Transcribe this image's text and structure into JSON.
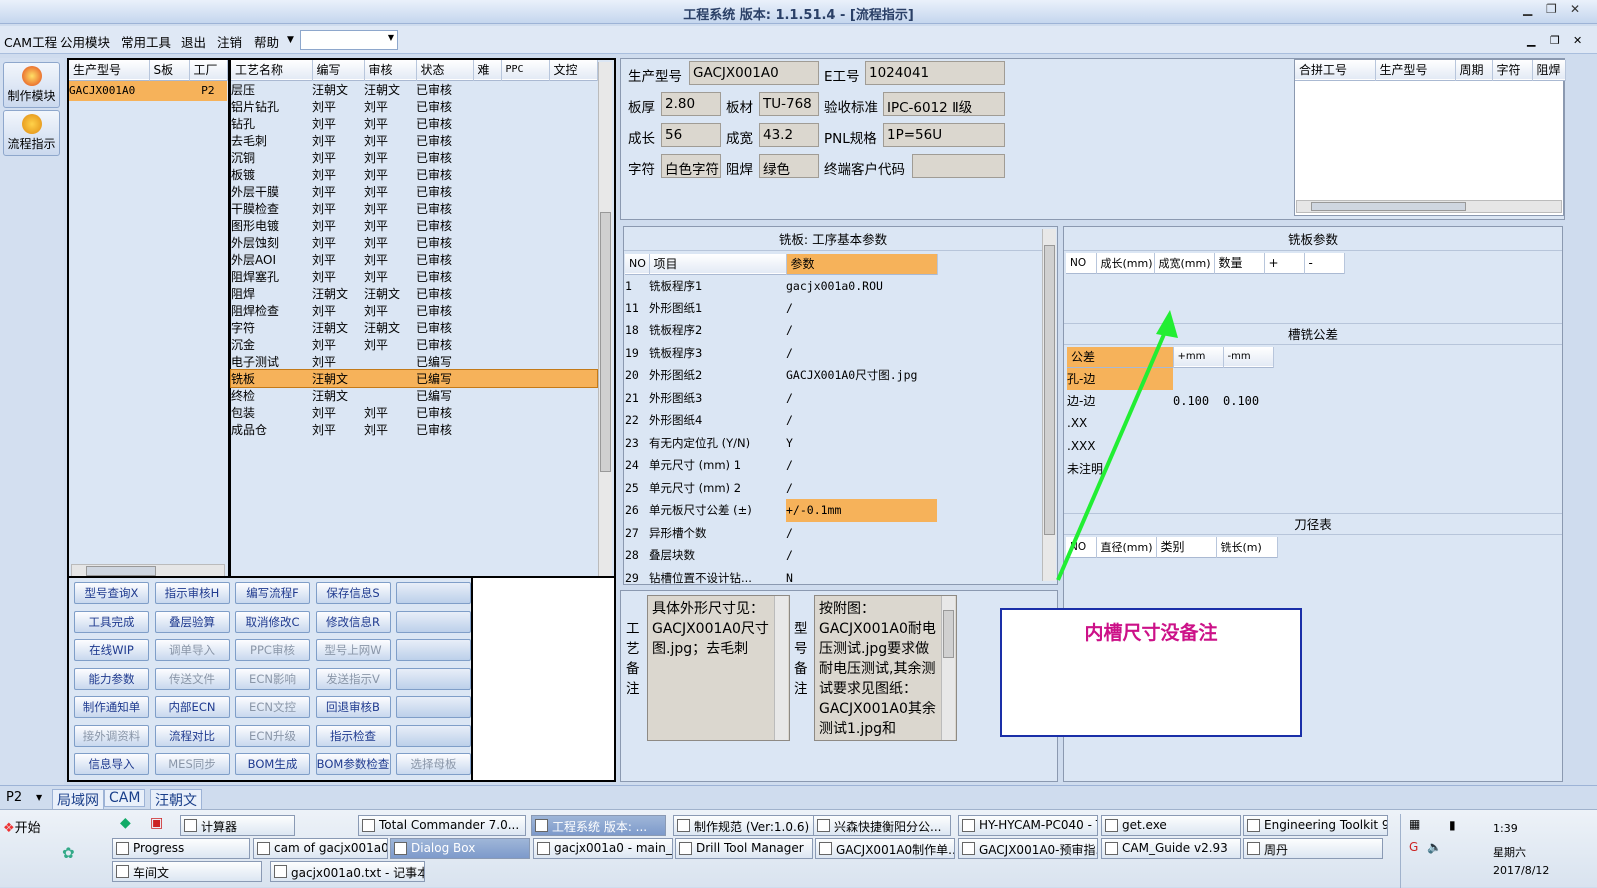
{
  "window": {
    "title": "工程系统  版本: 1.1.51.4 - [流程指示]"
  },
  "menu": [
    "CAM工程",
    "公用模块",
    "常用工具",
    "退出",
    "注销",
    "帮助"
  ],
  "left_tools": [
    {
      "label": "制作模块"
    },
    {
      "label": "流程指示"
    }
  ],
  "models": {
    "headers": [
      "生产型号",
      "S板",
      "工厂"
    ],
    "rows": [
      [
        "GACJX001A0",
        "",
        "P2"
      ]
    ]
  },
  "process": {
    "headers": [
      "工艺名称",
      "编写",
      "审核",
      "状态",
      "难",
      "PPC",
      "文控"
    ],
    "rows": [
      [
        "层压",
        "汪朝文",
        "汪朝文",
        "已审核"
      ],
      [
        "铝片钻孔",
        "刘平",
        "刘平",
        "已审核"
      ],
      [
        "钻孔",
        "刘平",
        "刘平",
        "已审核"
      ],
      [
        "去毛刺",
        "刘平",
        "刘平",
        "已审核"
      ],
      [
        "沉铜",
        "刘平",
        "刘平",
        "已审核"
      ],
      [
        "板镀",
        "刘平",
        "刘平",
        "已审核"
      ],
      [
        "外层干膜",
        "刘平",
        "刘平",
        "已审核"
      ],
      [
        "干膜检查",
        "刘平",
        "刘平",
        "已审核"
      ],
      [
        "图形电镀",
        "刘平",
        "刘平",
        "已审核"
      ],
      [
        "外层蚀刻",
        "刘平",
        "刘平",
        "已审核"
      ],
      [
        "外层AOI",
        "刘平",
        "刘平",
        "已审核"
      ],
      [
        "阻焊塞孔",
        "刘平",
        "刘平",
        "已审核"
      ],
      [
        "阻焊",
        "汪朝文",
        "汪朝文",
        "已审核"
      ],
      [
        "阻焊检查",
        "刘平",
        "刘平",
        "已审核"
      ],
      [
        "字符",
        "汪朝文",
        "汪朝文",
        "已审核"
      ],
      [
        "沉金",
        "刘平",
        "刘平",
        "已审核"
      ],
      [
        "电子测试",
        "刘平",
        "",
        "已编写"
      ],
      [
        "铣板",
        "汪朝文",
        "",
        "已编写"
      ],
      [
        "终检",
        "汪朝文",
        "",
        "已编写"
      ],
      [
        "包装",
        "刘平",
        "刘平",
        "已审核"
      ],
      [
        "成品仓",
        "刘平",
        "刘平",
        "已审核"
      ]
    ],
    "highlight_index": 17
  },
  "buttons": [
    [
      {
        "t": "型号查询X",
        "d": false
      },
      {
        "t": "指示审核H",
        "d": false
      },
      {
        "t": "编写流程F",
        "d": false
      },
      {
        "t": "保存信息S",
        "d": false
      },
      {
        "t": "",
        "d": false
      }
    ],
    [
      {
        "t": "工具完成",
        "d": false
      },
      {
        "t": "叠层验算",
        "d": false
      },
      {
        "t": "取消修改C",
        "d": false
      },
      {
        "t": "修改信息R",
        "d": false
      },
      {
        "t": "",
        "d": false
      }
    ],
    [
      {
        "t": "在线WIP",
        "d": false
      },
      {
        "t": "调单导入",
        "d": true
      },
      {
        "t": "PPC审核",
        "d": true
      },
      {
        "t": "型号上网W",
        "d": true
      },
      {
        "t": "",
        "d": false
      }
    ],
    [
      {
        "t": "能力参数",
        "d": false
      },
      {
        "t": "传送文件",
        "d": true
      },
      {
        "t": "ECN影响",
        "d": true
      },
      {
        "t": "发送指示V",
        "d": true
      },
      {
        "t": "",
        "d": false
      }
    ],
    [
      {
        "t": "制作通知单",
        "d": false
      },
      {
        "t": "内部ECN",
        "d": false
      },
      {
        "t": "ECN文控",
        "d": true
      },
      {
        "t": "回退审核B",
        "d": false
      },
      {
        "t": "",
        "d": false
      }
    ],
    [
      {
        "t": "接外调资料",
        "d": true
      },
      {
        "t": "流程对比",
        "d": false
      },
      {
        "t": "ECN升级",
        "d": true
      },
      {
        "t": "指示检查",
        "d": false
      },
      {
        "t": "",
        "d": false
      }
    ],
    [
      {
        "t": "信息导入",
        "d": false
      },
      {
        "t": "MES同步",
        "d": true
      },
      {
        "t": "BOM生成",
        "d": false
      },
      {
        "t": "BOM参数检查",
        "d": false
      },
      {
        "t": "选择母板",
        "d": true
      }
    ]
  ],
  "info": {
    "l_model": "生产型号",
    "model": "GACJX001A0",
    "l_e": "E工号",
    "e": "1024041",
    "l_thick": "板厚",
    "thick": "2.80",
    "l_mat": "板材",
    "mat": "TU-768",
    "l_std": "验收标准",
    "std": "IPC-6012 Ⅱ级",
    "l_len": "成长",
    "len": "56",
    "l_wid": "成宽",
    "wid": "43.2",
    "l_pnl": "PNL规格",
    "pnl": "1P=56U",
    "l_char": "字符",
    "char": "白色字符",
    "l_mask": "阻焊",
    "mask": "绿色",
    "l_cust": "终端客户代码",
    "cust": ""
  },
  "merge": {
    "headers": [
      "合拼工号",
      "生产型号",
      "周期",
      "字符",
      "阻焊"
    ]
  },
  "params": {
    "title": "铣板: 工序基本参数",
    "headers": [
      "NO",
      "项目",
      "参数"
    ],
    "rows": [
      [
        "1",
        "铣板程序1",
        "gacjx001a0.ROU"
      ],
      [
        "11",
        "外形图纸1",
        "/"
      ],
      [
        "18",
        "铣板程序2",
        "/"
      ],
      [
        "19",
        "铣板程序3",
        "/"
      ],
      [
        "20",
        "外形图纸2",
        "GACJX001A0尺寸图.jpg"
      ],
      [
        "21",
        "外形图纸3",
        "/"
      ],
      [
        "22",
        "外形图纸4",
        "/"
      ],
      [
        "23",
        "有无内定位孔 (Y/N)",
        "Y"
      ],
      [
        "24",
        "单元尺寸 (mm) 1",
        "/"
      ],
      [
        "25",
        "单元尺寸 (mm) 2",
        "/"
      ],
      [
        "26",
        "单元板尺寸公差 (±)",
        "+/-0.1mm"
      ],
      [
        "27",
        "异形槽个数",
        "/"
      ],
      [
        "28",
        "叠层块数",
        "/"
      ],
      [
        "29",
        "钻槽位置不设计钻...",
        "N"
      ]
    ],
    "highlight_index": 10
  },
  "mill": {
    "title": "铣板参数",
    "headers": [
      "NO",
      "成长(mm)",
      "成宽(mm)",
      "数量",
      "+",
      "-"
    ]
  },
  "tol": {
    "title": "槽铣公差",
    "headers": [
      "公差",
      "+mm",
      "-mm"
    ],
    "rows": [
      [
        "孔-边",
        "",
        ""
      ],
      [
        "边-边",
        "0.100",
        "0.100"
      ],
      [
        ".XX",
        "",
        ""
      ],
      [
        ".XXX",
        "",
        ""
      ],
      [
        "未注明",
        "",
        ""
      ]
    ]
  },
  "tool": {
    "title": "刀径表",
    "headers": [
      "NO",
      "直径(mm)",
      "类别",
      "铣长(m)"
    ]
  },
  "notes": {
    "proc_label": "工艺备注",
    "proc_text": "具体外形尺寸见：GACJX001A0尺寸图.jpg；去毛刺",
    "model_label": "型号备注",
    "model_text": "按附图：GACJX001A0耐电压测试.jpg要求做耐电压测试,其余测试要求见图纸：GACJX001A0其余测试1.jpg和"
  },
  "annotation": {
    "text": "内槽尺寸没备注",
    "color": "#cc1188",
    "arrow_color": "#22ee33"
  },
  "status": {
    "factory": "P2",
    "tabs": [
      "局域网",
      "CAM",
      "汪朝文"
    ]
  },
  "taskbar": {
    "start": "开始",
    "row1": [
      "Progress",
      "计算器",
      "Total Commander 7.0...",
      "工程系统  版本: ...",
      "制作规范 (Ver:1.0.6)",
      "兴森快捷衡阳分公...",
      "HY-HYCAM-PC040 - T...",
      "get.exe",
      "Engineering Toolkit 9..."
    ],
    "row2": [
      "cam of gacjx001a0",
      "Dialog Box",
      "gacjx001a0 - main_qa",
      "Drill Tool Manager",
      "GACJX001A0制作单...",
      "GACJX001A0-预审指...",
      "CAM_Guide v2.93",
      "周丹"
    ],
    "row3": [
      "车间文",
      "gacjx001a0.txt - 记事本"
    ],
    "time": "1:39",
    "day": "星期六",
    "date": "2017/8/12"
  }
}
